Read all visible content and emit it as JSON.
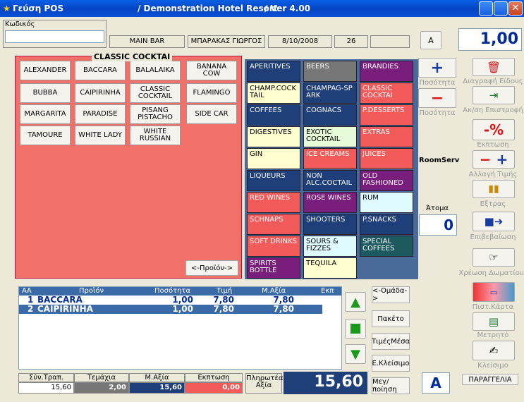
{
  "title": {
    "app": "Γεύση POS",
    "hotel": "/ Demonstration Hotel Resort",
    "version": "/ Ver 4.00"
  },
  "header": {
    "code_label": "Κωδικός",
    "outlet": "MAIN BAR",
    "user": "ΜΠΑΡΑΚΑΣ ΓΙΩΡΓΟΣ",
    "date": "8/10/2008",
    "table": "26",
    "mode": "A",
    "quantity": "1,00"
  },
  "cocktail_panel": {
    "title": "CLASSIC COCKTAI",
    "items": [
      [
        "ALEXANDER",
        "BACCARA",
        "BALALAIKA",
        "BANANA COW"
      ],
      [
        "BUBBA",
        "CAIPIRINHA",
        "CLASSIC COCKTAIL",
        "FLAMINGO"
      ],
      [
        "MARGARITA",
        "PARADISE",
        "PISANG PISTACHO",
        "SIDE CAR"
      ],
      [
        "TAMOURE",
        "WHITE LADY",
        "WHITE RUSSIAN",
        ""
      ]
    ],
    "prev_label": "<-Προϊόν->"
  },
  "categories": [
    {
      "label": "APERITIVES",
      "cls": "c-dblue"
    },
    {
      "label": "BEERS",
      "cls": "c-gray"
    },
    {
      "label": "BRANDIES",
      "cls": "c-purple"
    },
    {
      "label": "CHAMP.COCK TAIL",
      "cls": "c-lyellow"
    },
    {
      "label": "CHAMPAG-SP ARK",
      "cls": "c-dblue"
    },
    {
      "label": "CLASSIC COCKTAI",
      "cls": "c-red"
    },
    {
      "label": "COFFEES",
      "cls": "c-dblue"
    },
    {
      "label": "COGNACS",
      "cls": "c-dblue"
    },
    {
      "label": "P.DESSERTS",
      "cls": "c-red"
    },
    {
      "label": "DIGESTIVES",
      "cls": "c-lyellow"
    },
    {
      "label": "EXOTIC COCKTAIL",
      "cls": "c-lgreen"
    },
    {
      "label": "EXTRAS",
      "cls": "c-red"
    },
    {
      "label": "GIN",
      "cls": "c-lyellow"
    },
    {
      "label": "ICE CREAMS",
      "cls": "c-red"
    },
    {
      "label": "JUICES",
      "cls": "c-red"
    },
    {
      "label": "LIQUEURS",
      "cls": "c-dblue"
    },
    {
      "label": "NON ALC.COCTAIL",
      "cls": "c-dblue"
    },
    {
      "label": "OLD FASHIONED",
      "cls": "c-purple"
    },
    {
      "label": "RED WINES",
      "cls": "c-red"
    },
    {
      "label": "ROSE WINES",
      "cls": "c-purple"
    },
    {
      "label": "RUM",
      "cls": "c-lcyan"
    },
    {
      "label": "SCHNAPS",
      "cls": "c-red"
    },
    {
      "label": "SHOOTERS",
      "cls": "c-dblue"
    },
    {
      "label": "P.SNACKS",
      "cls": "c-dblue"
    },
    {
      "label": "SOFT DRINKS",
      "cls": "c-red"
    },
    {
      "label": "SOURS & FIZZES",
      "cls": "c-lcyan"
    },
    {
      "label": "SPECIAL COFFEES",
      "cls": "c-teal"
    },
    {
      "label": "SPIRITS BOTTLE",
      "cls": "c-purple"
    },
    {
      "label": "TEQUILA",
      "cls": "c-lyellow"
    },
    {
      "label": "",
      "cls": ""
    }
  ],
  "right_col": {
    "qty_plus": "Ποσότητα",
    "qty_minus": "Ποσότητα",
    "delete": "Διαγραφή Είδους",
    "return": "Ακ/ση Επιστροφή",
    "discount_sym": "-%",
    "discount": "Εκπτωση",
    "price_change": "Αλλαγή Τιμής",
    "extras": "Εξτρας",
    "confirm": "Επιβεβαίωση",
    "room_charge": "Χρέωση Δωματίου",
    "card": "Πιστ.Κάρτα",
    "cash": "Μετρητό",
    "close": "Κλείσιμο",
    "roomserv": "RoomServ",
    "persons_label": "Άτομα",
    "persons": "0",
    "order_mode": "A",
    "order": "ΠΑΡΑΓΓΕΛΙΑ"
  },
  "grid": {
    "headers": [
      "ΑΑ",
      "Προϊόν",
      "Ποσότητα",
      "Τιμή",
      "Μ.Αξία",
      "Εκπ"
    ],
    "rows": [
      [
        "1",
        "BACCARA",
        "1,00",
        "7,80",
        "7,80"
      ],
      [
        "2",
        "CAIPIRINHA",
        "1,00",
        "7,80",
        "7,80"
      ]
    ]
  },
  "side_buttons": {
    "group": "<-Ομάδα->",
    "package": "Πακέτο",
    "means": "ΤιμέςΜέσα",
    "eclose": "Ε.Κλείσιμο",
    "transfer": "Μεγ/ποίηση"
  },
  "totals": {
    "labels": [
      "Σύν.Τραπ.",
      "Τεμάχια",
      "Μ.Αξία",
      "Εκπτωση",
      "Πληρωτέα Αξία"
    ],
    "values": [
      "15,60",
      "2,00",
      "15,60",
      "0,00"
    ],
    "payable": "15,60"
  },
  "colors": {
    "panel_red": "#f1706a",
    "dark_blue": "#1f3f7a"
  }
}
